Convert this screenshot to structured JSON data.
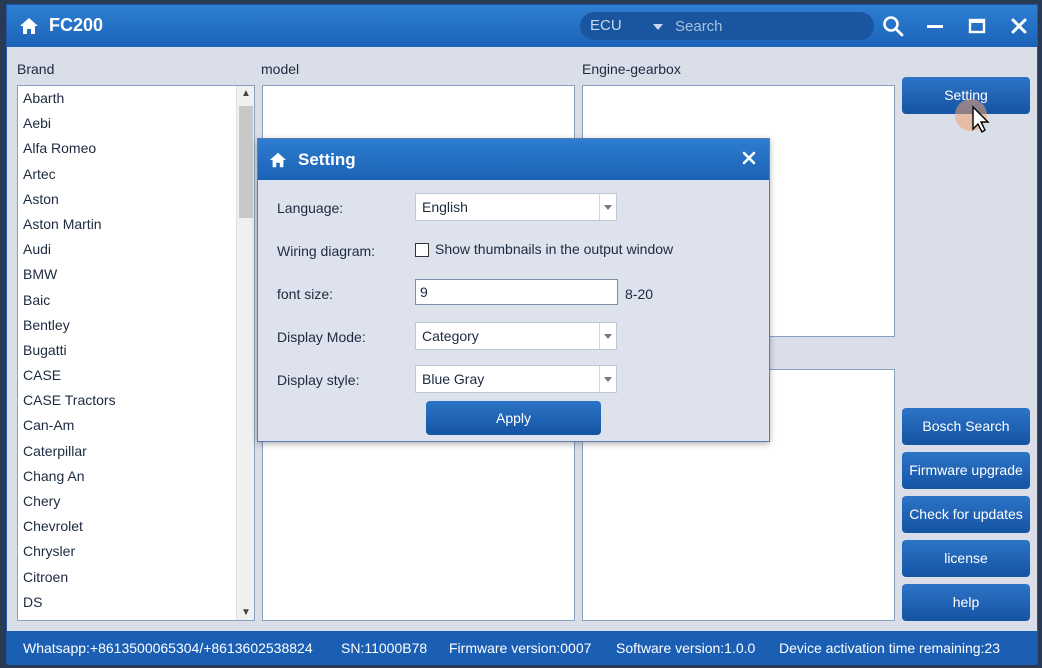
{
  "app": {
    "title": "FC200"
  },
  "search": {
    "category": "ECU",
    "placeholder": "Search"
  },
  "columns": {
    "brand": "Brand",
    "model": "model",
    "engine": "Engine-gearbox"
  },
  "brands": [
    "Abarth",
    "Aebi",
    "Alfa Romeo",
    "Artec",
    "Aston",
    "Aston Martin",
    "Audi",
    "BMW",
    "Baic",
    "Bentley",
    "Bugatti",
    "CASE",
    "CASE Tractors",
    "Can-Am",
    "Caterpillar",
    "Chang An",
    "Chery",
    "Chevrolet",
    "Chrysler",
    "Citroen",
    "DS"
  ],
  "side_buttons": {
    "setting": "Setting",
    "bosch_search": "Bosch Search",
    "firmware_upgrade": "Firmware upgrade",
    "check_updates": "Check for updates",
    "license": "license",
    "help": "help"
  },
  "dialog": {
    "title": "Setting",
    "language_label": "Language:",
    "language_value": "English",
    "wiring_label": "Wiring diagram:",
    "thumbnails_label": "Show thumbnails in the output window",
    "font_size_label": "font size:",
    "font_size_value": "9",
    "font_size_range": "8-20",
    "display_mode_label": "Display Mode:",
    "display_mode_value": "Category",
    "display_style_label": "Display style:",
    "display_style_value": "Blue Gray",
    "apply": "Apply"
  },
  "status": {
    "whatsapp": "Whatsapp:+8613500065304/+8613602538824",
    "sn": "SN:11000B78",
    "firmware": "Firmware version:0007",
    "software": "Software version:1.0.0",
    "activation": "Device activation time remaining:23"
  },
  "colors": {
    "accent": "#1b63b8",
    "status_bar": "#1b5fb5"
  }
}
